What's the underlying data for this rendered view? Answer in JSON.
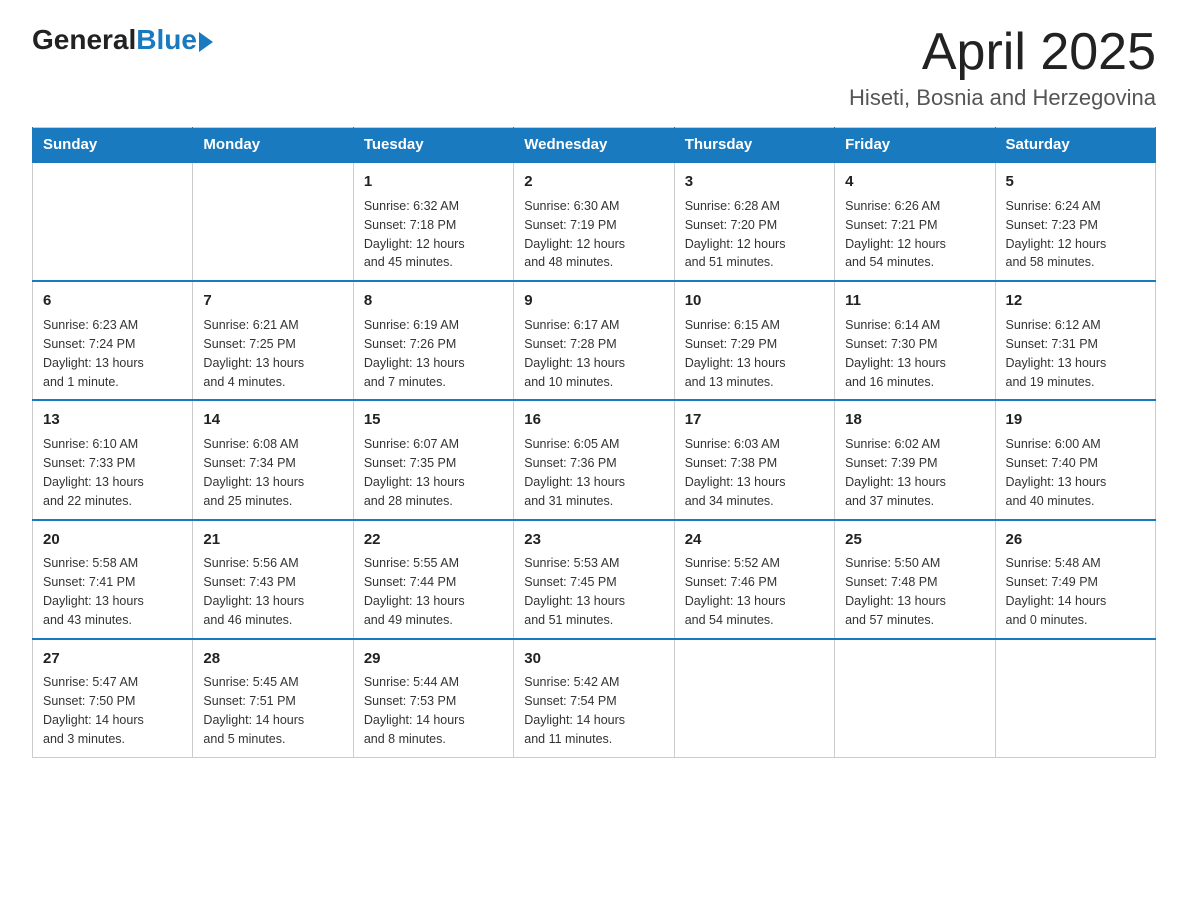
{
  "logo": {
    "general": "General",
    "blue": "Blue"
  },
  "title": "April 2025",
  "location": "Hiseti, Bosnia and Herzegovina",
  "days_of_week": [
    "Sunday",
    "Monday",
    "Tuesday",
    "Wednesday",
    "Thursday",
    "Friday",
    "Saturday"
  ],
  "weeks": [
    [
      {
        "day": "",
        "info": ""
      },
      {
        "day": "",
        "info": ""
      },
      {
        "day": "1",
        "info": "Sunrise: 6:32 AM\nSunset: 7:18 PM\nDaylight: 12 hours\nand 45 minutes."
      },
      {
        "day": "2",
        "info": "Sunrise: 6:30 AM\nSunset: 7:19 PM\nDaylight: 12 hours\nand 48 minutes."
      },
      {
        "day": "3",
        "info": "Sunrise: 6:28 AM\nSunset: 7:20 PM\nDaylight: 12 hours\nand 51 minutes."
      },
      {
        "day": "4",
        "info": "Sunrise: 6:26 AM\nSunset: 7:21 PM\nDaylight: 12 hours\nand 54 minutes."
      },
      {
        "day": "5",
        "info": "Sunrise: 6:24 AM\nSunset: 7:23 PM\nDaylight: 12 hours\nand 58 minutes."
      }
    ],
    [
      {
        "day": "6",
        "info": "Sunrise: 6:23 AM\nSunset: 7:24 PM\nDaylight: 13 hours\nand 1 minute."
      },
      {
        "day": "7",
        "info": "Sunrise: 6:21 AM\nSunset: 7:25 PM\nDaylight: 13 hours\nand 4 minutes."
      },
      {
        "day": "8",
        "info": "Sunrise: 6:19 AM\nSunset: 7:26 PM\nDaylight: 13 hours\nand 7 minutes."
      },
      {
        "day": "9",
        "info": "Sunrise: 6:17 AM\nSunset: 7:28 PM\nDaylight: 13 hours\nand 10 minutes."
      },
      {
        "day": "10",
        "info": "Sunrise: 6:15 AM\nSunset: 7:29 PM\nDaylight: 13 hours\nand 13 minutes."
      },
      {
        "day": "11",
        "info": "Sunrise: 6:14 AM\nSunset: 7:30 PM\nDaylight: 13 hours\nand 16 minutes."
      },
      {
        "day": "12",
        "info": "Sunrise: 6:12 AM\nSunset: 7:31 PM\nDaylight: 13 hours\nand 19 minutes."
      }
    ],
    [
      {
        "day": "13",
        "info": "Sunrise: 6:10 AM\nSunset: 7:33 PM\nDaylight: 13 hours\nand 22 minutes."
      },
      {
        "day": "14",
        "info": "Sunrise: 6:08 AM\nSunset: 7:34 PM\nDaylight: 13 hours\nand 25 minutes."
      },
      {
        "day": "15",
        "info": "Sunrise: 6:07 AM\nSunset: 7:35 PM\nDaylight: 13 hours\nand 28 minutes."
      },
      {
        "day": "16",
        "info": "Sunrise: 6:05 AM\nSunset: 7:36 PM\nDaylight: 13 hours\nand 31 minutes."
      },
      {
        "day": "17",
        "info": "Sunrise: 6:03 AM\nSunset: 7:38 PM\nDaylight: 13 hours\nand 34 minutes."
      },
      {
        "day": "18",
        "info": "Sunrise: 6:02 AM\nSunset: 7:39 PM\nDaylight: 13 hours\nand 37 minutes."
      },
      {
        "day": "19",
        "info": "Sunrise: 6:00 AM\nSunset: 7:40 PM\nDaylight: 13 hours\nand 40 minutes."
      }
    ],
    [
      {
        "day": "20",
        "info": "Sunrise: 5:58 AM\nSunset: 7:41 PM\nDaylight: 13 hours\nand 43 minutes."
      },
      {
        "day": "21",
        "info": "Sunrise: 5:56 AM\nSunset: 7:43 PM\nDaylight: 13 hours\nand 46 minutes."
      },
      {
        "day": "22",
        "info": "Sunrise: 5:55 AM\nSunset: 7:44 PM\nDaylight: 13 hours\nand 49 minutes."
      },
      {
        "day": "23",
        "info": "Sunrise: 5:53 AM\nSunset: 7:45 PM\nDaylight: 13 hours\nand 51 minutes."
      },
      {
        "day": "24",
        "info": "Sunrise: 5:52 AM\nSunset: 7:46 PM\nDaylight: 13 hours\nand 54 minutes."
      },
      {
        "day": "25",
        "info": "Sunrise: 5:50 AM\nSunset: 7:48 PM\nDaylight: 13 hours\nand 57 minutes."
      },
      {
        "day": "26",
        "info": "Sunrise: 5:48 AM\nSunset: 7:49 PM\nDaylight: 14 hours\nand 0 minutes."
      }
    ],
    [
      {
        "day": "27",
        "info": "Sunrise: 5:47 AM\nSunset: 7:50 PM\nDaylight: 14 hours\nand 3 minutes."
      },
      {
        "day": "28",
        "info": "Sunrise: 5:45 AM\nSunset: 7:51 PM\nDaylight: 14 hours\nand 5 minutes."
      },
      {
        "day": "29",
        "info": "Sunrise: 5:44 AM\nSunset: 7:53 PM\nDaylight: 14 hours\nand 8 minutes."
      },
      {
        "day": "30",
        "info": "Sunrise: 5:42 AM\nSunset: 7:54 PM\nDaylight: 14 hours\nand 11 minutes."
      },
      {
        "day": "",
        "info": ""
      },
      {
        "day": "",
        "info": ""
      },
      {
        "day": "",
        "info": ""
      }
    ]
  ]
}
